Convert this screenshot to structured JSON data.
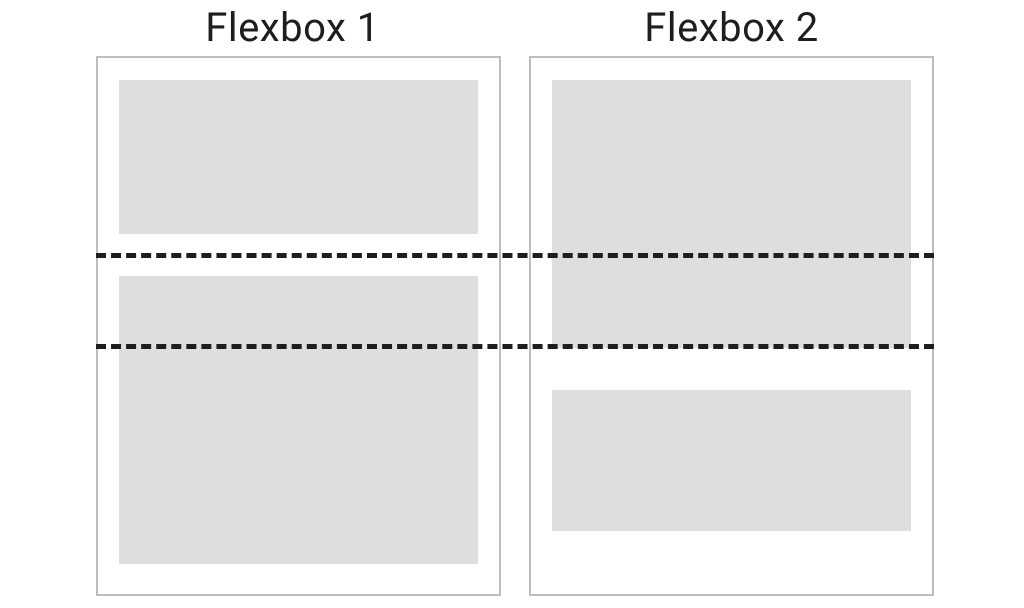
{
  "diagram": {
    "title_1": "Flexbox 1",
    "title_2": "Flexbox 2"
  }
}
